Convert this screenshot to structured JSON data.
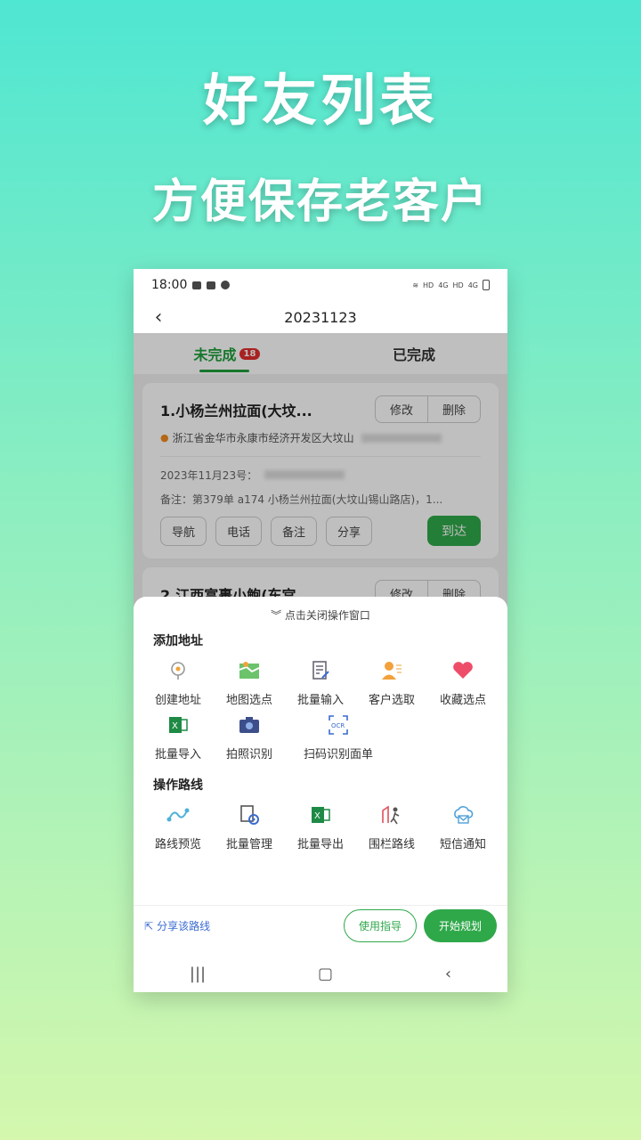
{
  "headline": {
    "line1": "好友列表",
    "line2": "方便保存老客户"
  },
  "status": {
    "time": "18:00",
    "net1": "HD",
    "net2": "4G",
    "net3": "HD",
    "net4": "4G"
  },
  "nav": {
    "back_icon": "‹",
    "title": "20231123"
  },
  "tabs": [
    {
      "label": "未完成",
      "badge": "18"
    },
    {
      "label": "已完成"
    }
  ],
  "cards": [
    {
      "title": "1.小杨兰州拉面(大坟...",
      "edit": "修改",
      "delete": "删除",
      "address": "浙江省金华市永康市经济开发区大坟山",
      "date_label": "2023年11月23号：",
      "note": "备注：第379单 a174 小杨兰州拉面(大坟山锡山路店)，1...",
      "actions": [
        "导航",
        "电话",
        "备注",
        "分享"
      ],
      "arrive": "到达"
    },
    {
      "title": "2.江西富裹小鲍(东宫",
      "edit": "修改",
      "delete": "删除"
    }
  ],
  "sheet": {
    "close": "点击关闭操作窗口",
    "section1": "添加地址",
    "items1": [
      {
        "label": "创建地址",
        "icon": "location-pin-icon"
      },
      {
        "label": "地图选点",
        "icon": "map-icon"
      },
      {
        "label": "批量输入",
        "icon": "edit-doc-icon"
      },
      {
        "label": "客户选取",
        "icon": "customer-icon"
      },
      {
        "label": "收藏选点",
        "icon": "heart-icon"
      },
      {
        "label": "批量导入",
        "icon": "excel-import-icon"
      },
      {
        "label": "拍照识别",
        "icon": "camera-icon"
      },
      {
        "label": "扫码识别面单",
        "icon": "ocr-icon"
      }
    ],
    "section2": "操作路线",
    "items2": [
      {
        "label": "路线预览",
        "icon": "route-preview-icon"
      },
      {
        "label": "批量管理",
        "icon": "batch-manage-icon"
      },
      {
        "label": "批量导出",
        "icon": "excel-export-icon"
      },
      {
        "label": "围栏路线",
        "icon": "fence-route-icon"
      },
      {
        "label": "短信通知",
        "icon": "sms-cloud-icon"
      }
    ],
    "share": "分享该路线",
    "guide": "使用指导",
    "plan": "开始规划"
  },
  "colors": {
    "accent": "#2fa84a",
    "badge": "#e02e2e",
    "link": "#3a6bd1"
  }
}
